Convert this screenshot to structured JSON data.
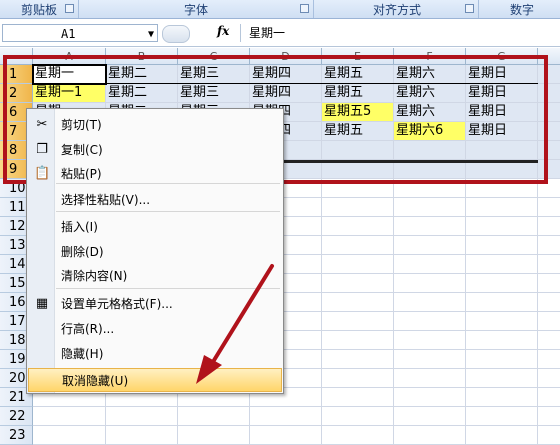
{
  "ribbon": {
    "groups": [
      {
        "label": "剪贴板"
      },
      {
        "label": "字体"
      },
      {
        "label": "对齐方式"
      },
      {
        "label": "数字"
      }
    ]
  },
  "formula_bar": {
    "name_box": "A1",
    "fx_label": "fx",
    "content": "星期一"
  },
  "columns": [
    "A",
    "B",
    "C",
    "D",
    "E",
    "F",
    "G"
  ],
  "rows": [
    "1",
    "2",
    "6",
    "7",
    "8",
    "9",
    "10",
    "11",
    "12",
    "13",
    "14",
    "15",
    "16",
    "17",
    "18",
    "19",
    "20",
    "21",
    "22",
    "23"
  ],
  "grid": {
    "row1": [
      "星期一",
      "星期二",
      "星期三",
      "星期四",
      "星期五",
      "星期六",
      "星期日"
    ],
    "row2": [
      "星期一1",
      "星期二",
      "星期三",
      "星期四",
      "星期五",
      "星期六",
      "星期日"
    ],
    "row6": [
      "星期一",
      "星期二",
      "星期三",
      "星期四",
      "星期五5",
      "星期六",
      "星期日"
    ],
    "row7": [
      "星期一",
      "星期二",
      "星期三",
      "星期四",
      "星期五",
      "星期六6",
      "星期日"
    ]
  },
  "context_menu": {
    "items": [
      {
        "label": "剪切(T)",
        "icon": "scissors-icon"
      },
      {
        "label": "复制(C)",
        "icon": "copy-icon"
      },
      {
        "label": "粘贴(P)",
        "icon": "paste-icon"
      },
      {
        "label": "选择性粘贴(V)...",
        "icon": ""
      },
      {
        "label": "插入(I)",
        "icon": ""
      },
      {
        "label": "删除(D)",
        "icon": ""
      },
      {
        "label": "清除内容(N)",
        "icon": ""
      },
      {
        "label": "设置单元格格式(F)...",
        "icon": "format-cells-icon"
      },
      {
        "label": "行高(R)...",
        "icon": ""
      },
      {
        "label": "隐藏(H)",
        "icon": ""
      },
      {
        "label": "取消隐藏(U)",
        "icon": ""
      }
    ],
    "highlighted": "取消隐藏(U)"
  },
  "colors": {
    "annotation_red": "#b0121b",
    "highlight_yellow": "#ffff66",
    "selected_row_header": "#f0b54a"
  }
}
